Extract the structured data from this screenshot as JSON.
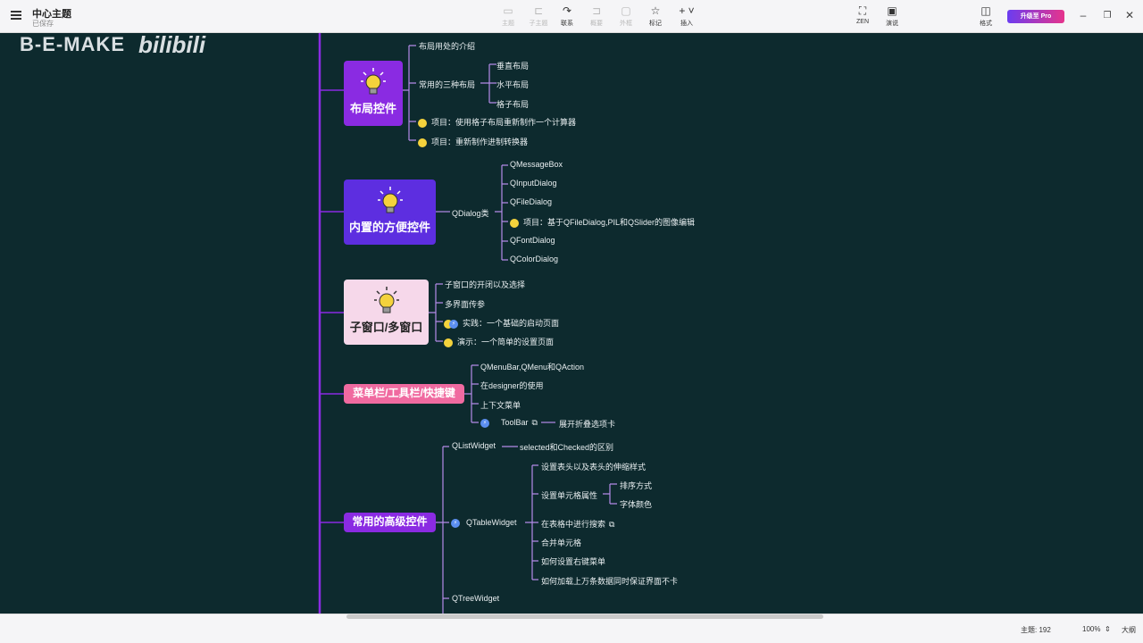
{
  "window": {
    "title": "中心主题",
    "subtitle": "已保存"
  },
  "toolbar": {
    "items": [
      {
        "label": "主题",
        "icon": "topic-icon",
        "active": false
      },
      {
        "label": "子主题",
        "icon": "subtopic-icon",
        "active": false
      },
      {
        "label": "联系",
        "icon": "relationship-icon",
        "active": true
      },
      {
        "label": "概要",
        "icon": "summary-icon",
        "active": false
      },
      {
        "label": "外框",
        "icon": "boundary-icon",
        "active": false
      },
      {
        "label": "笔记",
        "icon": "note-icon",
        "active": false
      },
      {
        "label": "标记",
        "icon": "star-icon",
        "active": true
      },
      {
        "label": "插入",
        "icon": "plus-icon",
        "active": true
      }
    ],
    "right_items": [
      {
        "label": "ZEN",
        "icon": "zen-icon"
      },
      {
        "label": "演说",
        "icon": "pitch-icon"
      },
      {
        "label": "格式",
        "icon": "format-icon"
      }
    ],
    "pro_button": "升级至 Pro"
  },
  "watermark": {
    "left": "B-E-MAKE",
    "right": "bilibili"
  },
  "mindmap": {
    "layout": {
      "title": "布局控件",
      "children": [
        "布局用处的介绍",
        "常用的三种布局",
        "项目：使用格子布局重新制作一个计算器",
        "项目：重新制作进制转换器"
      ],
      "sub": [
        "垂直布局",
        "水平布局",
        "格子布局"
      ]
    },
    "dialogs": {
      "title": "内置的方便控件",
      "branch": "QDialog类",
      "children": [
        "QMessageBox",
        "QInputDialog",
        "QFileDialog",
        "项目：基于QFileDialog,PIL和QSlider的图像编辑",
        "QFontDialog",
        "QColorDialog"
      ]
    },
    "subwindow": {
      "title": "子窗口/多窗口",
      "children": [
        "子窗口的开闭以及选择",
        "多界面传参",
        "实践：一个基础的启动页面",
        "演示：一个简单的设置页面"
      ]
    },
    "menubar": {
      "title": "菜单栏/工具栏/快捷键",
      "children": [
        "QMenuBar,QMenu和QAction",
        "在designer的使用",
        "上下文菜单",
        "ToolBar"
      ],
      "toolbar_child": "展开折叠选项卡"
    },
    "advanced": {
      "title": "常用的高级控件",
      "list_widget": "QListWidget",
      "list_child": "selected和Checked的区别",
      "table_widget": "QTableWidget",
      "table_children": [
        "设置表头以及表头的伸缩样式",
        "设置单元格属性",
        "在表格中进行搜索",
        "合并单元格",
        "如何设置右键菜单",
        "如何加载上万条数据同时保证界面不卡"
      ],
      "cell_props": [
        "排序方式",
        "字体颜色"
      ],
      "tree_widget": "QTreeWidget"
    }
  },
  "statusbar": {
    "topics": "主题: 192",
    "zoom": "100%",
    "size": "大纲"
  },
  "colors": {
    "purple": "#8a2be2",
    "violet": "#5d2ee0",
    "pink_light": "#f6d8ea",
    "pink": "#f06aa0",
    "line": "#8a2be2"
  }
}
